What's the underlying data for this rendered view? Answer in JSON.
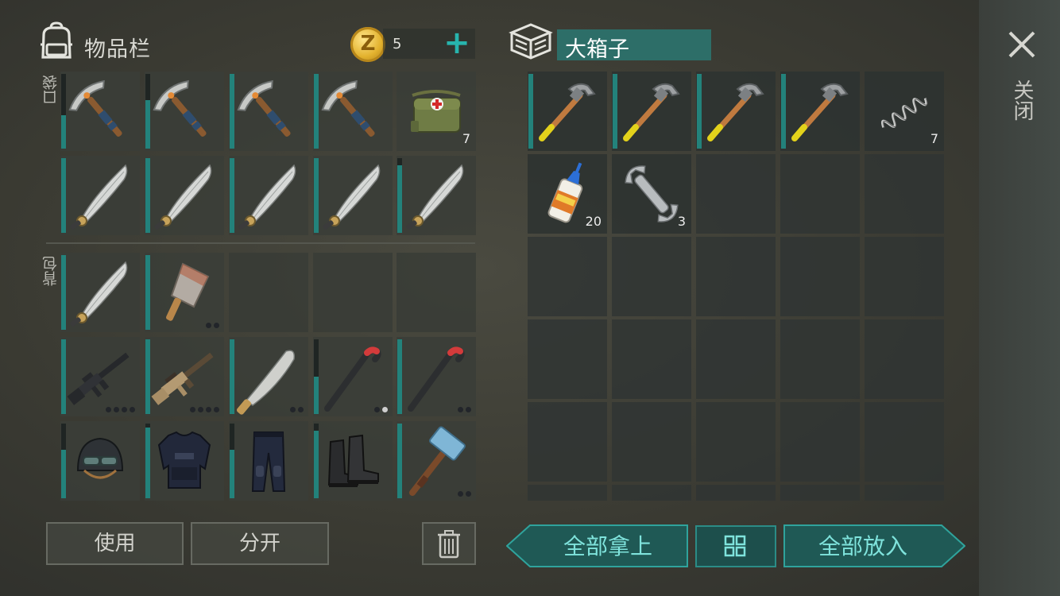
{
  "inventory": {
    "title": "物品栏",
    "coins": "5",
    "coin_symbol": "Z",
    "add_label": "+",
    "pockets_label": "口袋",
    "backpack_label": "背包"
  },
  "container": {
    "title": "大箱子"
  },
  "close_label": "关闭",
  "pocket_slots": [
    {
      "item": "pickaxe-icon",
      "durability": 0.45
    },
    {
      "item": "pickaxe-icon",
      "durability": 0.65
    },
    {
      "item": "pickaxe-icon",
      "durability": 1.0
    },
    {
      "item": "pickaxe-icon",
      "durability": 1.0
    },
    {
      "item": "medical-bag-icon",
      "qty": "7"
    },
    {
      "item": "katana-icon",
      "durability": 1.0
    },
    {
      "item": "katana-icon",
      "durability": 1.0
    },
    {
      "item": "katana-icon",
      "durability": 1.0
    },
    {
      "item": "katana-icon",
      "durability": 1.0
    },
    {
      "item": "katana-icon",
      "durability": 0.9
    }
  ],
  "backpack_slots": [
    {
      "item": "katana-icon",
      "durability": 1.0
    },
    {
      "item": "cleaver-icon",
      "durability": 1.0,
      "dots": 2,
      "dots_on": 0
    },
    {
      "item": "empty"
    },
    {
      "item": "empty"
    },
    {
      "item": "empty"
    },
    {
      "item": "m16-rifle-icon",
      "durability": 1.0,
      "dots": 4,
      "dots_on": 0
    },
    {
      "item": "scar-rifle-icon",
      "durability": 1.0,
      "dots": 4,
      "dots_on": 0
    },
    {
      "item": "machete-icon",
      "durability": 1.0,
      "dots": 2,
      "dots_on": 0
    },
    {
      "item": "crowbar-icon",
      "durability": 0.5,
      "dots": 2,
      "dots_on": 1
    },
    {
      "item": "crowbar-icon",
      "durability": 1.0,
      "dots": 2,
      "dots_on": 0
    },
    {
      "item": "military-helmet-icon",
      "durability": 0.65
    },
    {
      "item": "police-vest-icon",
      "durability": 0.95
    },
    {
      "item": "police-pants-icon",
      "durability": 0.65
    },
    {
      "item": "boots-icon",
      "durability": 0.9
    },
    {
      "item": "sledgehammer-icon",
      "durability": 1.0,
      "dots": 2,
      "dots_on": 0
    }
  ],
  "container_slots": [
    {
      "item": "hammer-icon",
      "durability": 1.0
    },
    {
      "item": "hammer-icon",
      "durability": 1.0
    },
    {
      "item": "hammer-icon",
      "durability": 1.0
    },
    {
      "item": "hammer-icon",
      "durability": 1.0
    },
    {
      "item": "spring-icon",
      "qty": "7"
    },
    {
      "item": "glue-icon",
      "qty": "20"
    },
    {
      "item": "wrench-icon",
      "qty": "3"
    }
  ],
  "buttons": {
    "use": "使用",
    "split": "分开",
    "take_all": "全部拿上",
    "put_all": "全部放入"
  },
  "colors": {
    "accent": "#27b4ad",
    "durability": "#23827b",
    "container_title_bg": "#2d6e68"
  }
}
